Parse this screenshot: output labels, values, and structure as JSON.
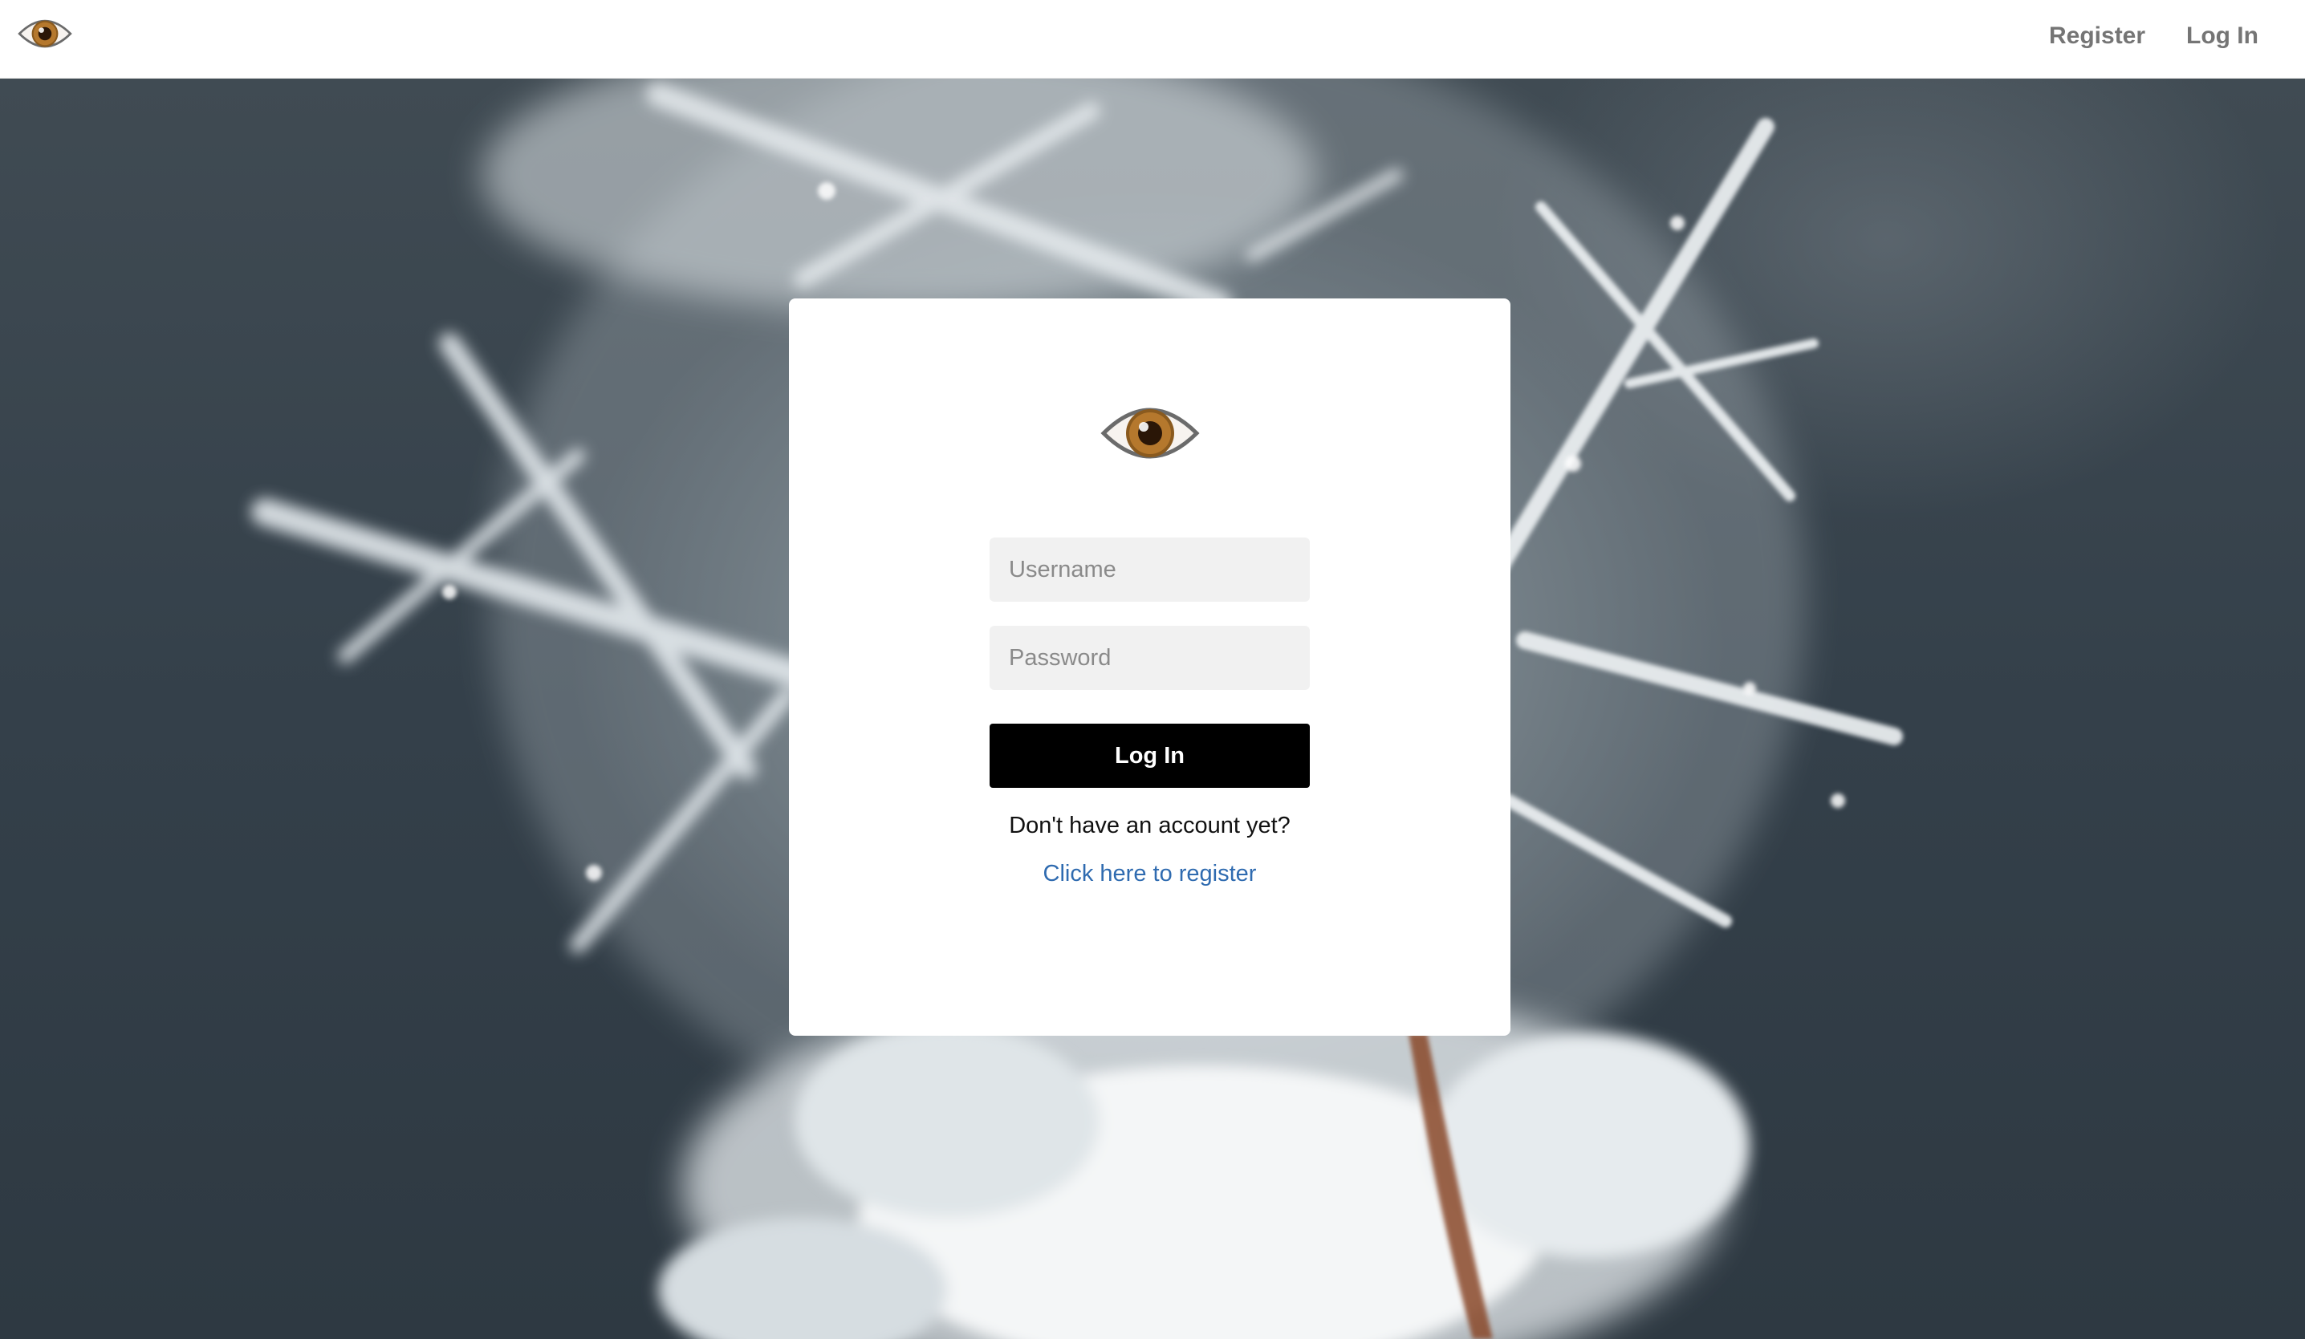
{
  "nav": {
    "logo_icon": "eye-icon",
    "register_label": "Register",
    "login_label": "Log In"
  },
  "login_form": {
    "logo_icon": "eye-icon",
    "username_placeholder": "Username",
    "password_placeholder": "Password",
    "submit_label": "Log In",
    "no_account_text": "Don't have an account yet?",
    "register_link_text": "Click here to register"
  },
  "colors": {
    "button_bg": "#000000",
    "button_text": "#ffffff",
    "link": "#2f6bb0",
    "nav_link": "#757575",
    "input_bg": "#f1f1f1",
    "background": "#3b454d"
  }
}
